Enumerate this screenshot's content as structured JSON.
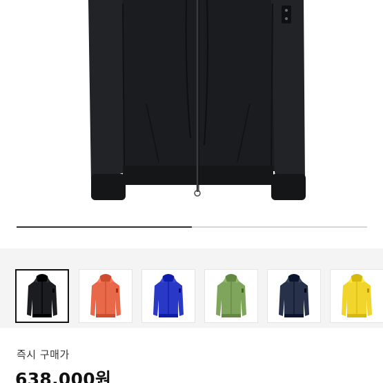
{
  "gallery": {
    "progress_fraction": 0.5,
    "hero_color": "#1b1c1f",
    "thumbnails": [
      {
        "color": "#1b1c1f",
        "icon": "black-jacket-icon",
        "selected": true
      },
      {
        "color": "#e8684a",
        "icon": "orange-jacket-icon",
        "selected": false
      },
      {
        "color": "#2a38c6",
        "icon": "blue-jacket-icon",
        "selected": false
      },
      {
        "color": "#7fa55c",
        "icon": "green-jacket-icon",
        "selected": false
      },
      {
        "color": "#273149",
        "icon": "navy-jacket-icon",
        "selected": false
      },
      {
        "color": "#f1d52c",
        "icon": "yellow-jacket-icon",
        "selected": false
      }
    ]
  },
  "price": {
    "label": "즉시 구매가",
    "value": "638,000원"
  }
}
